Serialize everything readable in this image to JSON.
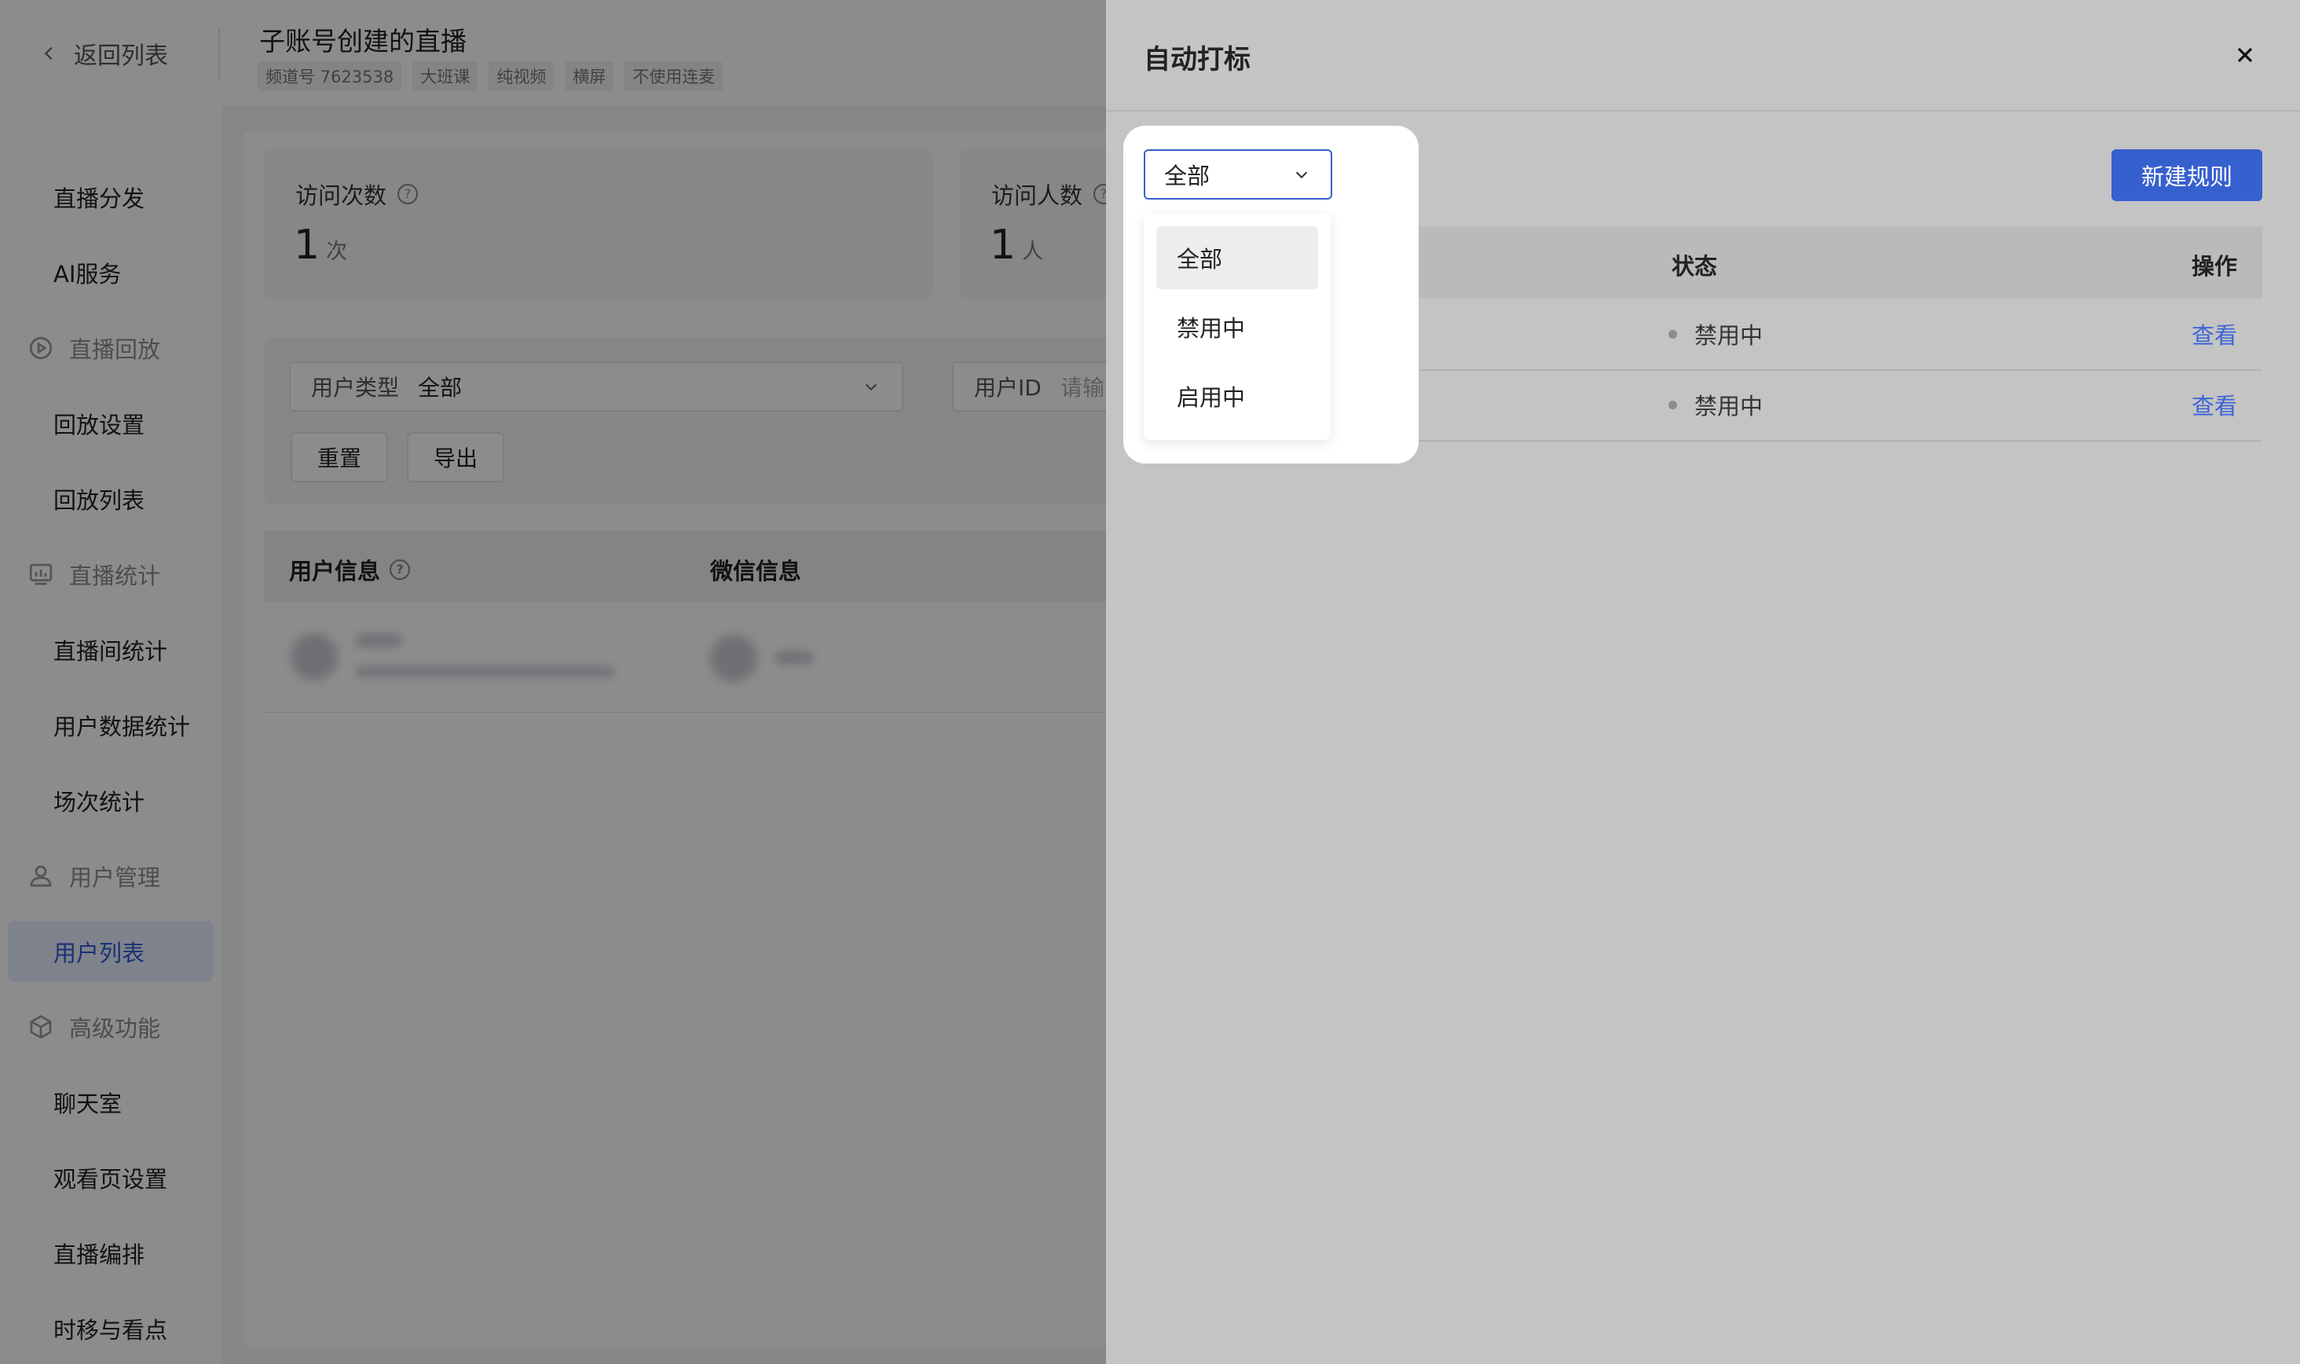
{
  "header": {
    "back_label": "返回列表",
    "title": "子账号创建的直播",
    "tags": [
      "频道号 7623538",
      "大班课",
      "纯视频",
      "横屏",
      "不使用连麦"
    ]
  },
  "sidebar": {
    "items": [
      {
        "label": "直播分发",
        "type": "item"
      },
      {
        "label": "AI服务",
        "type": "item"
      },
      {
        "label": "直播回放",
        "type": "group",
        "icon": "replay-icon"
      },
      {
        "label": "回放设置",
        "type": "item"
      },
      {
        "label": "回放列表",
        "type": "item"
      },
      {
        "label": "直播统计",
        "type": "group",
        "icon": "stats-icon"
      },
      {
        "label": "直播间统计",
        "type": "item"
      },
      {
        "label": "用户数据统计",
        "type": "item"
      },
      {
        "label": "场次统计",
        "type": "item"
      },
      {
        "label": "用户管理",
        "type": "group",
        "icon": "user-icon"
      },
      {
        "label": "用户列表",
        "type": "item",
        "active": true
      },
      {
        "label": "高级功能",
        "type": "group",
        "icon": "cube-icon"
      },
      {
        "label": "聊天室",
        "type": "item"
      },
      {
        "label": "观看页设置",
        "type": "item"
      },
      {
        "label": "直播编排",
        "type": "item"
      },
      {
        "label": "时移与看点",
        "type": "item"
      }
    ]
  },
  "stats": {
    "visits": {
      "label": "访问次数",
      "value": "1",
      "unit": "次"
    },
    "visitors": {
      "label": "访问人数",
      "value": "1",
      "unit": "人"
    }
  },
  "filters": {
    "user_type_label": "用户类型",
    "user_type_value": "全部",
    "user_id_label": "用户ID",
    "user_id_placeholder": "请输入",
    "reset_label": "重置",
    "export_label": "导出"
  },
  "table": {
    "col_user_info": "用户信息",
    "col_wechat_info": "微信信息"
  },
  "drawer": {
    "title": "自动打标",
    "new_rule_label": "新建规则",
    "status_filter": {
      "selected": "全部",
      "options": [
        "全部",
        "禁用中",
        "启用中"
      ]
    },
    "columns": {
      "status": "状态",
      "action": "操作"
    },
    "rows": [
      {
        "status": "禁用中",
        "action": "查看"
      },
      {
        "status": "禁用中",
        "action": "查看"
      }
    ]
  },
  "colors": {
    "primary": "#3760cf",
    "link": "#3c65d6",
    "active_nav_bg": "#e8efff"
  }
}
